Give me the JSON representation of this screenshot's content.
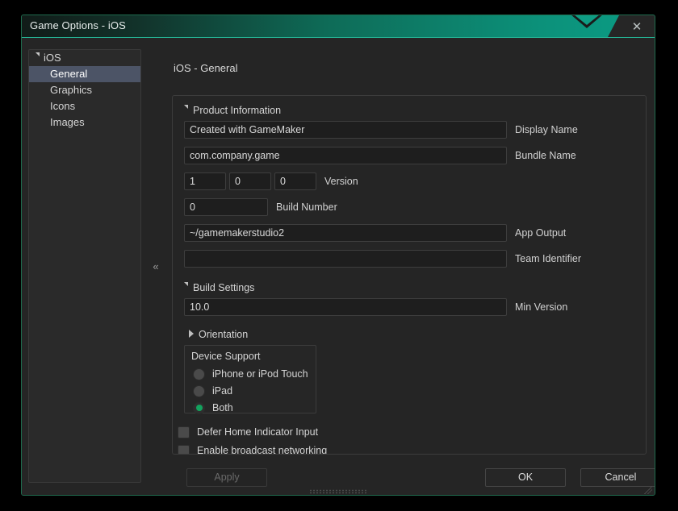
{
  "window": {
    "title": "Game Options - iOS",
    "close_icon": "close-icon"
  },
  "sidebar": {
    "root": {
      "label": "iOS",
      "expand_icon": "triangle-down-icon"
    },
    "items": [
      {
        "label": "General",
        "selected": true
      },
      {
        "label": "Graphics",
        "selected": false
      },
      {
        "label": "Icons",
        "selected": false
      },
      {
        "label": "Images",
        "selected": false
      }
    ],
    "collapse_handle": "«"
  },
  "content": {
    "title": "iOS - General",
    "sections": {
      "product_information": {
        "label": "Product Information",
        "expanded": true,
        "fields": {
          "display_name": {
            "value": "Created with GameMaker",
            "label": "Display Name",
            "placeholder": ""
          },
          "bundle_name": {
            "value": "com.company.game",
            "label": "Bundle Name",
            "placeholder": ""
          },
          "version": {
            "label": "Version",
            "major": "1",
            "minor": "0",
            "patch": "0"
          },
          "build_number": {
            "value": "0",
            "label": "Build Number",
            "placeholder": ""
          },
          "app_output": {
            "value": "~/gamemakerstudio2",
            "label": "App Output",
            "placeholder": ""
          },
          "team_identifier": {
            "value": "",
            "label": "Team Identifier",
            "placeholder": ""
          }
        }
      },
      "build_settings": {
        "label": "Build Settings",
        "expanded": true,
        "min_version": {
          "value": "10.0",
          "label": "Min Version",
          "placeholder": ""
        },
        "orientation": {
          "label": "Orientation",
          "expanded": false
        }
      },
      "device_support": {
        "label": "Device Support",
        "options": [
          {
            "label": "iPhone or iPod Touch",
            "selected": false
          },
          {
            "label": "iPad",
            "selected": false
          },
          {
            "label": "Both",
            "selected": true
          }
        ]
      },
      "checkboxes": [
        {
          "label": "Defer Home Indicator Input",
          "checked": false
        },
        {
          "label": "Enable broadcast networking",
          "checked": false
        }
      ]
    }
  },
  "footer": {
    "apply": {
      "label": "Apply",
      "enabled": false
    },
    "ok": {
      "label": "OK",
      "enabled": true
    },
    "cancel": {
      "label": "Cancel",
      "enabled": true
    }
  },
  "colors": {
    "titlebar_accent": "#0a9d85",
    "window_border": "#1f6b4e",
    "selection": "#4c5466",
    "radio_on": "#13a35e"
  }
}
